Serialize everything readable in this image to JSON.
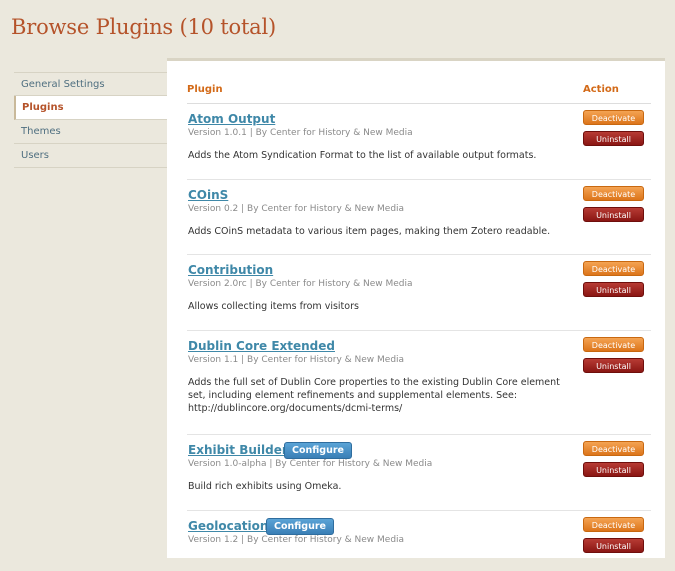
{
  "page": {
    "title": "Browse Plugins (10 total)"
  },
  "sidebar": {
    "items": [
      {
        "label": "General Settings"
      },
      {
        "label": "Plugins"
      },
      {
        "label": "Themes"
      },
      {
        "label": "Users"
      }
    ]
  },
  "table": {
    "headers": {
      "plugin": "Plugin",
      "action": "Action"
    },
    "deactivate_label": "Deactivate",
    "uninstall_label": "Uninstall",
    "configure_label": "Configure",
    "plugins": [
      {
        "name": "Atom Output",
        "meta": "Version 1.0.1 | By Center for History & New Media",
        "description": "Adds the Atom Syndication Format to the list of available output formats."
      },
      {
        "name": "COinS",
        "meta": "Version 0.2 | By Center for History & New Media",
        "description": "Adds COinS metadata to various item pages, making them Zotero readable."
      },
      {
        "name": "Contribution",
        "meta": "Version 2.0rc | By Center for History & New Media",
        "description": "Allows collecting items from visitors"
      },
      {
        "name": "Dublin Core Extended",
        "meta": "Version 1.1 | By Center for History & New Media",
        "description": "Adds the full set of Dublin Core properties to the existing Dublin Core element set, including element refinements and supplemental elements. See: http://dublincore.org/documents/dcmi-terms/"
      },
      {
        "name": "Exhibit Builder",
        "meta": "Version 1.0-alpha | By Center for History & New Media",
        "description": "Build rich exhibits using Omeka."
      },
      {
        "name": "Geolocation",
        "meta": "Version 1.2 | By Center for History & New Media",
        "description": ""
      }
    ]
  }
}
